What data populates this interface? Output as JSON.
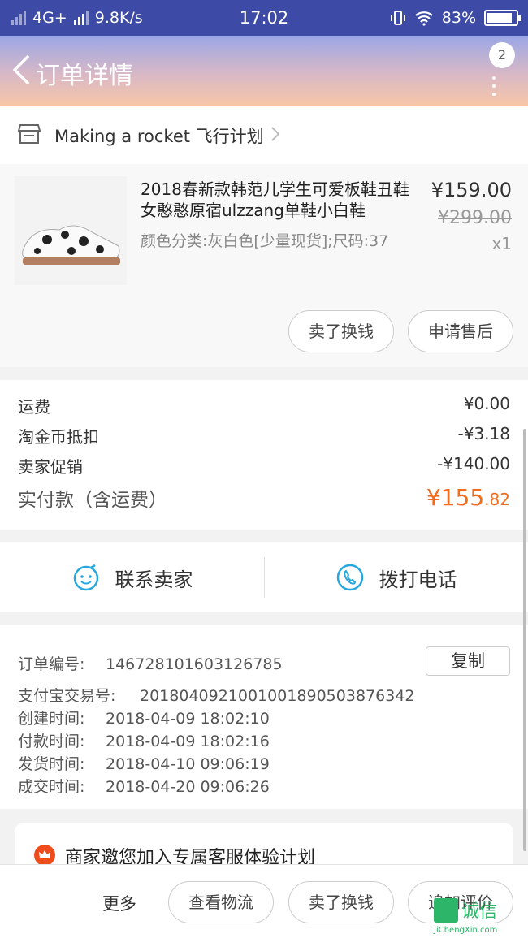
{
  "status_bar": {
    "network": "4G+",
    "speed": "9.8K/s",
    "time": "17:02",
    "battery": "83%"
  },
  "header": {
    "title": "订单详情",
    "badge_count": "2"
  },
  "shop": {
    "name": "Making a rocket 飞行计划"
  },
  "item": {
    "title": "2018春新款韩范儿学生可爱板鞋丑鞋女憨憨原宿ulzzang单鞋小白鞋",
    "sku": "颜色分类:灰白色[少量现货];尺码:37",
    "price": "¥159.00",
    "original_price": "¥299.00",
    "quantity": "x1",
    "buttons": {
      "sell": "卖了换钱",
      "after_sale": "申请售后"
    }
  },
  "costs": {
    "shipping_label": "运费",
    "shipping_value": "¥0.00",
    "coin_label": "淘金币抵扣",
    "coin_value": "-¥3.18",
    "promo_label": "卖家促销",
    "promo_value": "-¥140.00",
    "total_label": "实付款（含运费）",
    "total_int": "¥155",
    "total_dec": ".82"
  },
  "contact": {
    "seller": "联系卖家",
    "call": "拨打电话"
  },
  "order_info": {
    "order_no_label": "订单编号:",
    "order_no": "146728101603126785",
    "copy": "复制",
    "alipay_label": "支付宝交易号:",
    "alipay_no": "2018040921001001890503876342",
    "created_label": "创建时间:",
    "created": "2018-04-09 18:02:10",
    "paid_label": "付款时间:",
    "paid": "2018-04-09 18:02:16",
    "shipped_label": "发货时间:",
    "shipped": "2018-04-10 09:06:19",
    "done_label": "成交时间:",
    "done": "2018-04-20 09:06:26"
  },
  "promo_banner": {
    "text": "商家邀您加入专属客服体验计划"
  },
  "bottom_bar": {
    "more": "更多",
    "logistics": "查看物流",
    "sell": "卖了换钱",
    "review": "追加评价"
  },
  "watermark": {
    "text": "诚信",
    "url": "JiChengXin.com"
  },
  "colors": {
    "status_bar": "#3d4aa6",
    "accent_price": "#f36b1c",
    "contact_icon": "#27a7e0"
  }
}
